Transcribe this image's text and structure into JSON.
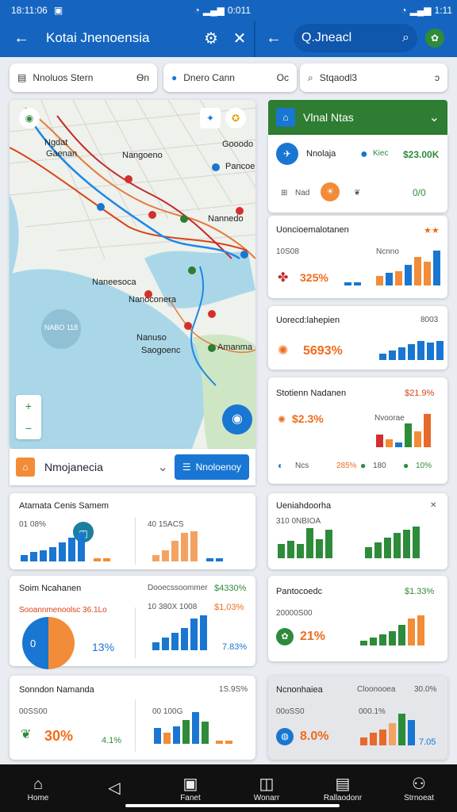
{
  "status": {
    "left_time": "18:11:06",
    "mid_time": "0:011",
    "right_time": "1:11"
  },
  "left_panel": {
    "title": "Kotai Jnenoensia",
    "search_placeholder": "Q.Jneacl"
  },
  "chips": [
    {
      "label": "Nnoluos Stern",
      "extra": "Ѳn"
    },
    {
      "label": "Dnero Cann",
      "extra": "Oc"
    },
    {
      "label": "Stqaodl3",
      "extra": "ɔ"
    }
  ],
  "map": {
    "labels": [
      "Ngdat",
      "Gaenan",
      "Nangoeno",
      "Gooodo",
      "Pancoer",
      "Nannedo",
      "Naneesoca",
      "Nanoconera",
      "Nanuso",
      "Amanma",
      "Saogoenc"
    ],
    "badge_text": "NABO 118"
  },
  "location_bar": {
    "name": "Nmojanecia",
    "button_label": "Nnoloenoy"
  },
  "right_header": {
    "title": "Vlnal Ntas",
    "icon_label": "Nnolaja",
    "stat_label": "Kiec",
    "stat_value": "$23.00K",
    "row2_a": "Nad",
    "row2_value": "0/0"
  },
  "cards": {
    "r1": {
      "title": "Uoncioemalotanen",
      "sub": "10S08",
      "sub2": "Ncnno",
      "value": "325%",
      "flag": "★★"
    },
    "r2": {
      "title": "Uorecd:lahepien",
      "corner": "8003",
      "value": "5693%"
    },
    "r3": {
      "title": "Stotienn Nadanen",
      "corner": "$21.9%",
      "value": "$2.3%",
      "sub": "Nvoorae",
      "f1": "Ncs",
      "f2": "285%",
      "f3": "180",
      "f4": "10%"
    },
    "l1": {
      "title": "Atamata Cenis Samem",
      "sub": "01 08%",
      "sub2": "40 15ACS"
    },
    "l2": {
      "title": "Soim Ncahanen",
      "sub": "Sooannmenoolsc 36.1Lo",
      "corner_l": "Dooecssoommer",
      "corner_r": "$4330%",
      "sub2": "10 380X 1008",
      "v2": "$1,03%",
      "v3": "13%",
      "v4": "7.83%",
      "pie": "0"
    },
    "r4": {
      "title": "Ueniahdoorha",
      "sub": "310 0NBIOA"
    },
    "r5": {
      "title": "Pantocoedc",
      "corner": "$1.33%",
      "sub": "20000S00",
      "value": "21%"
    },
    "l3": {
      "title": "Sonndon Namanda",
      "corner": "1S.9S%",
      "sub": "00SS00",
      "v1": "30%",
      "v2": "4.1%",
      "sub2": "00 100G"
    },
    "r6": {
      "title": "Ncnonhaiea",
      "corner_l": "Cloonooea",
      "corner_r": "30.0%",
      "sub": "00oSS0",
      "value": "8.0%",
      "sub2": "000.1%",
      "v2": "7.05"
    }
  },
  "nav": [
    {
      "label": "Home",
      "icon": "home-icon"
    },
    {
      "label": "",
      "icon": "back-icon"
    },
    {
      "label": "Fanet",
      "icon": "wallet-icon"
    },
    {
      "label": "Wonarr",
      "icon": "chart-icon"
    },
    {
      "label": "Rallaodonr",
      "icon": "book-icon"
    },
    {
      "label": "Strnoeat",
      "icon": "person-icon"
    }
  ],
  "colors": {
    "blue": "#1976d2",
    "orange": "#f28c38",
    "green": "#2e8b3a",
    "header_green": "#2e7d32"
  }
}
